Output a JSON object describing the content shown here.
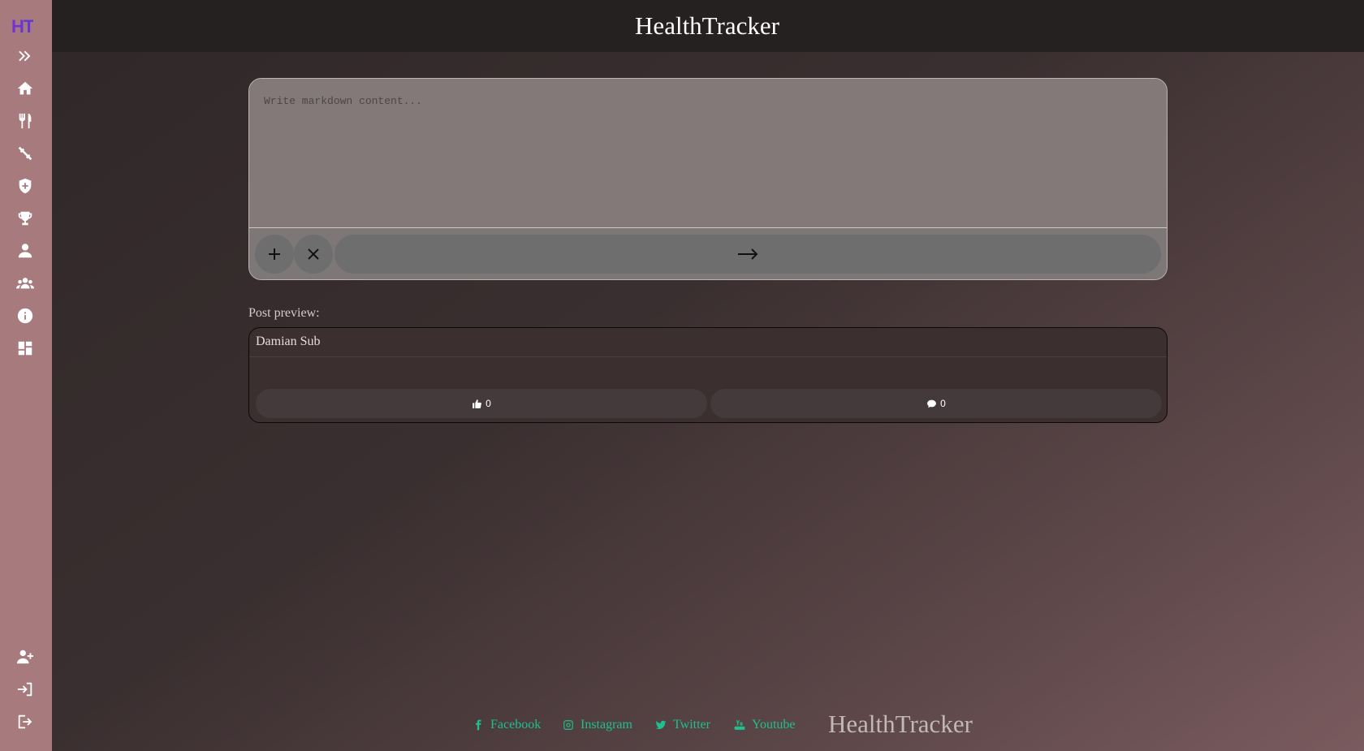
{
  "app": {
    "logo": "HT",
    "title": "HealthTracker"
  },
  "sidebar": {
    "items": [
      {
        "icon": "expand-icon"
      },
      {
        "icon": "home-icon"
      },
      {
        "icon": "utensils-icon"
      },
      {
        "icon": "dumbbell-icon"
      },
      {
        "icon": "shield-plus-icon"
      },
      {
        "icon": "trophy-icon"
      },
      {
        "icon": "user-icon"
      },
      {
        "icon": "users-icon"
      },
      {
        "icon": "info-icon"
      },
      {
        "icon": "dashboard-icon"
      }
    ],
    "bottom_items": [
      {
        "icon": "user-plus-icon"
      },
      {
        "icon": "login-icon"
      },
      {
        "icon": "logout-icon"
      }
    ]
  },
  "editor": {
    "placeholder": "Write markdown content...",
    "value": ""
  },
  "preview": {
    "label": "Post preview:",
    "author": "Damian Sub",
    "likes": "0",
    "comments": "0"
  },
  "footer": {
    "links": [
      {
        "label": "Facebook",
        "icon": "facebook-icon"
      },
      {
        "label": "Instagram",
        "icon": "instagram-icon"
      },
      {
        "label": "Twitter",
        "icon": "twitter-icon"
      },
      {
        "label": "Youtube",
        "icon": "youtube-icon"
      }
    ],
    "brand": "HealthTracker"
  },
  "colors": {
    "sidebar": "#a77a7d",
    "topbar": "#242120",
    "accent_logo": "#7b2fd6",
    "social_link": "#1fbf8f"
  }
}
